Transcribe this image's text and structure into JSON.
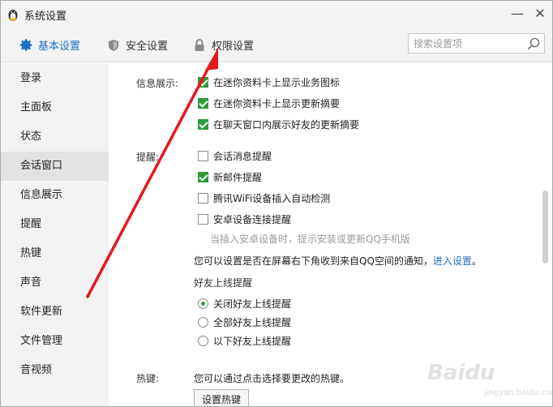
{
  "window": {
    "title": "系统设置",
    "title_icon": "penguin-icon",
    "minimize_glyph": "—",
    "close_glyph": "✕"
  },
  "tabs": [
    {
      "label": "基本设置",
      "icon": "gear-icon",
      "active": true
    },
    {
      "label": "安全设置",
      "icon": "shield-icon",
      "active": false
    },
    {
      "label": "权限设置",
      "icon": "lock-icon",
      "active": false
    }
  ],
  "search": {
    "placeholder": "搜索设置项",
    "value": ""
  },
  "sidebar": {
    "items": [
      {
        "label": "登录"
      },
      {
        "label": "主面板"
      },
      {
        "label": "状态"
      },
      {
        "label": "会话窗口"
      },
      {
        "label": "信息展示"
      },
      {
        "label": "提醒"
      },
      {
        "label": "热键"
      },
      {
        "label": "声音"
      },
      {
        "label": "软件更新"
      },
      {
        "label": "文件管理"
      },
      {
        "label": "音视频"
      }
    ],
    "active_index": 3
  },
  "content": {
    "info_display": {
      "label": "信息展示:",
      "options": [
        {
          "text": "在迷你资料卡上显示业务图标",
          "checked": true
        },
        {
          "text": "在迷你资料卡上显示更新摘要",
          "checked": true
        },
        {
          "text": "在聊天窗口内展示好友的更新摘要",
          "checked": true
        }
      ]
    },
    "reminder": {
      "label": "提醒:",
      "options": [
        {
          "text": "会话消息提醒",
          "checked": false
        },
        {
          "text": "新邮件提醒",
          "checked": true
        },
        {
          "text": "腾讯WiFi设备插入自动检测",
          "checked": false
        },
        {
          "text": "安卓设备连接提醒",
          "checked": false
        }
      ],
      "hint": "当插入安卓设备时，提示安装或更新QQ手机版",
      "qzone_text": "您可以设置是否在屏幕右下角收到来自QQ空间的通知，",
      "qzone_link": "进入设置",
      "qzone_end": "。",
      "friend_online_title": "好友上线提醒",
      "radios": [
        {
          "text": "关闭好友上线提醒",
          "checked": true
        },
        {
          "text": "全部好友上线提醒",
          "checked": false
        },
        {
          "text": "以下好友上线提醒",
          "checked": false
        }
      ]
    },
    "hotkey": {
      "label": "热键:",
      "text": "您可以通过点击选择要更改的热键。",
      "button": "设置热键"
    }
  },
  "watermark": {
    "text": "Baidu",
    "sub": "jingyan.baidu.com"
  },
  "colors": {
    "accent": "#1d6fc4",
    "check": "#2e9a3a",
    "arrow": "#e8171b"
  }
}
